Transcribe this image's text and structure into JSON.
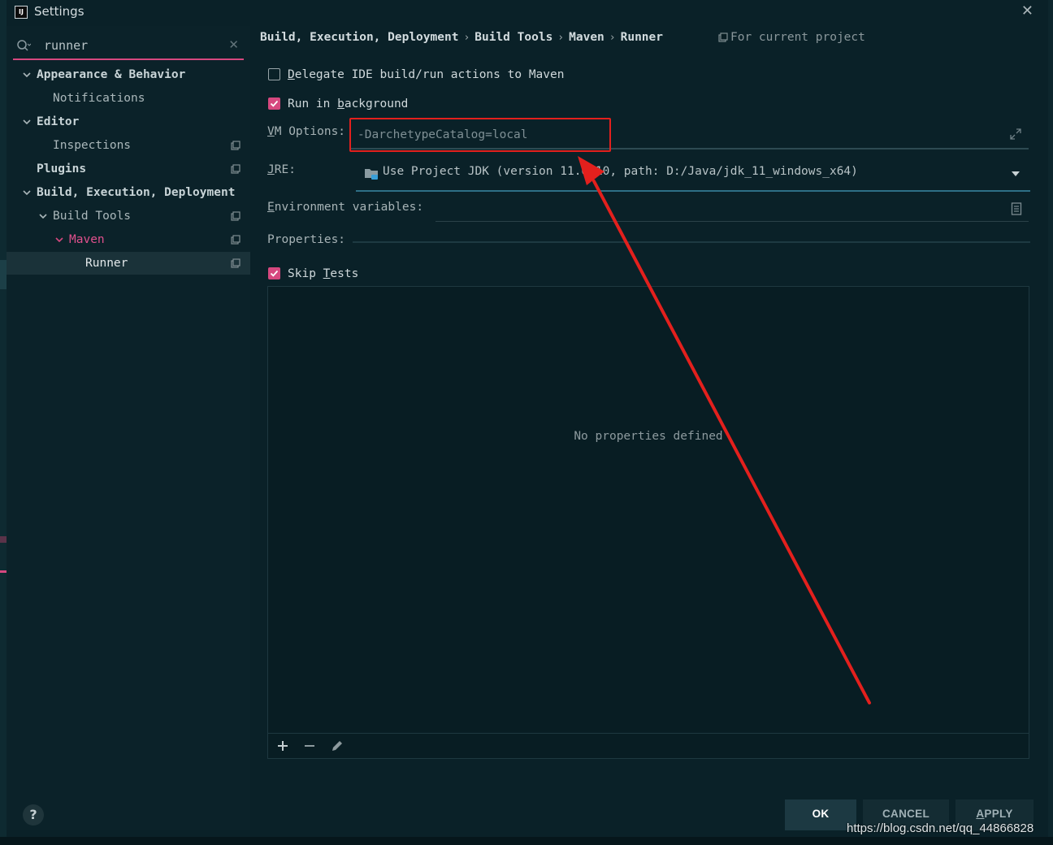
{
  "window": {
    "title": "Settings"
  },
  "search": {
    "value": "runner"
  },
  "tree": [
    {
      "label": "Appearance & Behavior"
    },
    {
      "label": "Notifications"
    },
    {
      "label": "Editor"
    },
    {
      "label": "Inspections"
    },
    {
      "label": "Plugins"
    },
    {
      "label": "Build, Execution, Deployment"
    },
    {
      "label": "Build Tools"
    },
    {
      "label": "Maven"
    },
    {
      "label": "Runner"
    }
  ],
  "breadcrumb": [
    "Build, Execution, Deployment",
    "Build Tools",
    "Maven",
    "Runner"
  ],
  "scope_note": "For current project",
  "options": {
    "delegate": {
      "label_pre": "",
      "label_u": "D",
      "label_post": "elegate IDE build/run actions to Maven",
      "checked": false
    },
    "background": {
      "label_pre": "Run in ",
      "label_u": "b",
      "label_post": "ackground",
      "checked": true
    },
    "skip_tests": {
      "label_pre": "Skip ",
      "label_u": "T",
      "label_post": "ests",
      "checked": true
    }
  },
  "vm_options": {
    "label_u": "V",
    "label_post": "M Options:",
    "value": "-DarchetypeCatalog=local"
  },
  "jre": {
    "label_u": "J",
    "label_post": "RE:",
    "value": "Use Project JDK (version 11.0.10, path: D:/Java/jdk_11_windows_x64)"
  },
  "env": {
    "label_u": "E",
    "label_post": "nvironment variables:",
    "value": ""
  },
  "properties": {
    "label": "Properties:",
    "empty_text": "No properties defined"
  },
  "buttons": {
    "ok": "OK",
    "cancel": "CANCEL",
    "apply_u": "A",
    "apply_post": "PPLY",
    "help": "?"
  },
  "watermark": "https://blog.csdn.net/qq_44866828",
  "colors": {
    "accent": "#d6487f",
    "annotation": "#e3201d",
    "background": "#0a2128"
  }
}
